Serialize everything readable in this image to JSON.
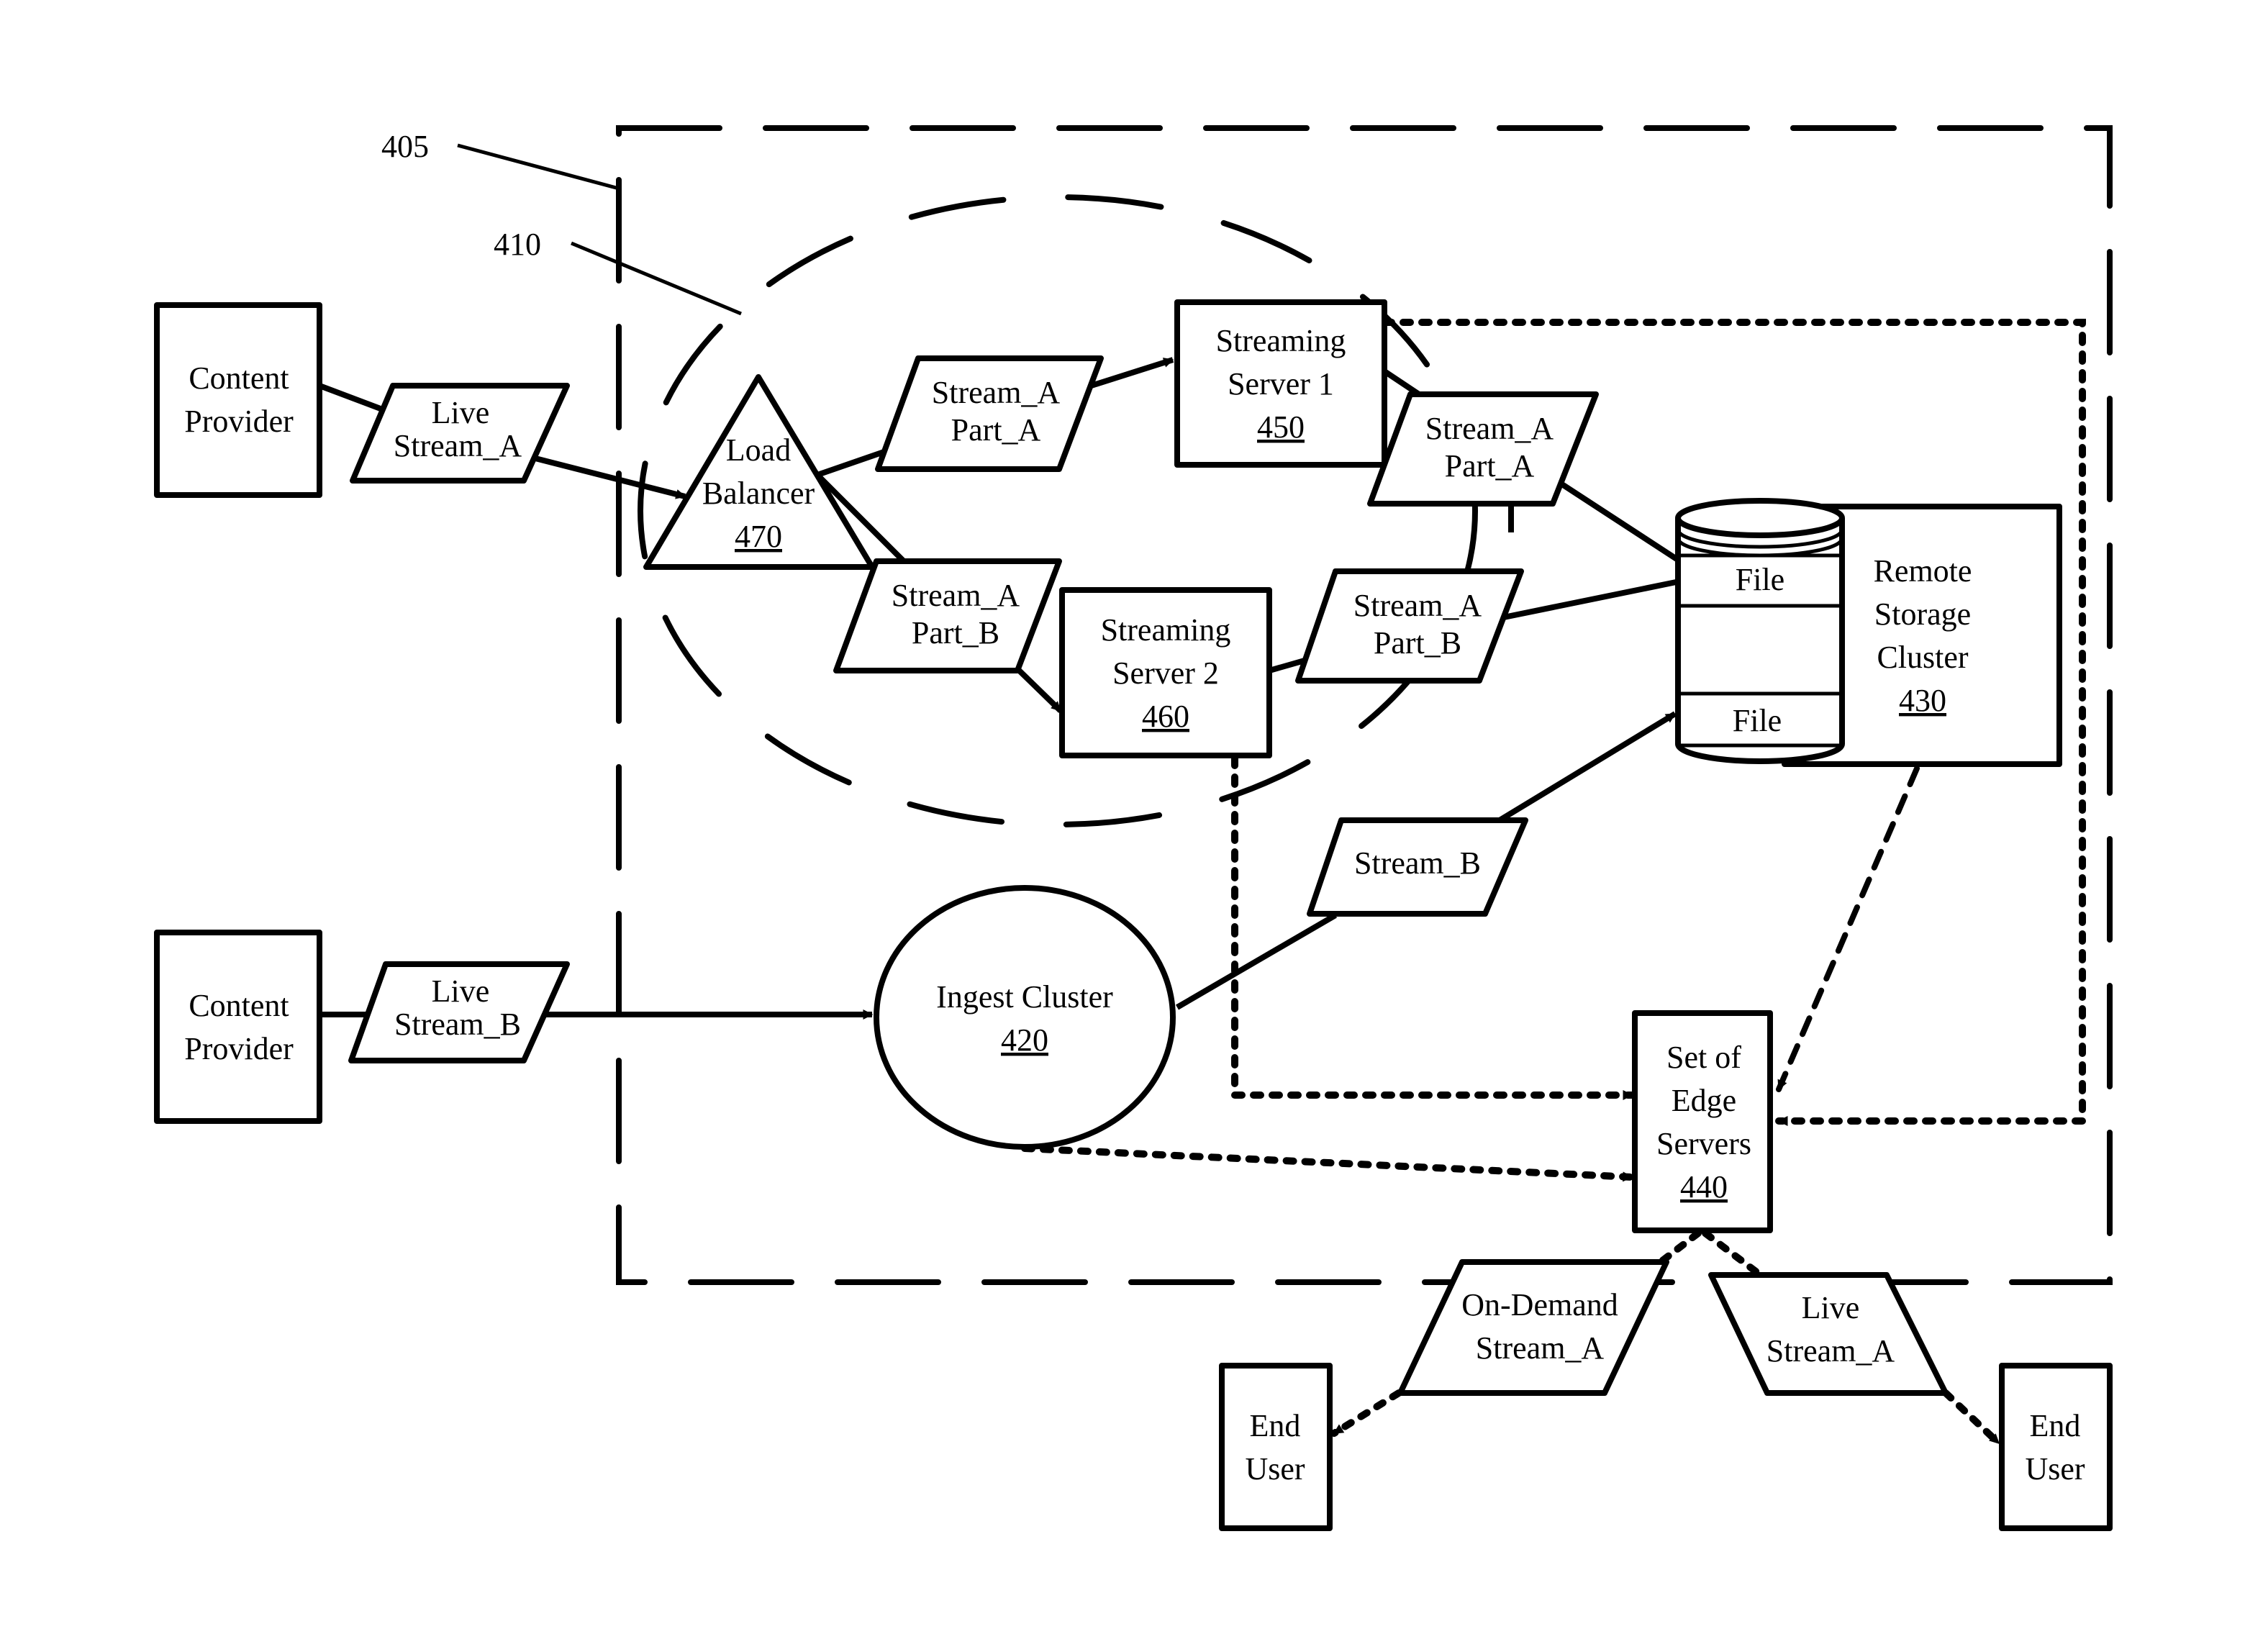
{
  "figure": {
    "callouts": {
      "outer_region": "405",
      "inner_region": "410"
    },
    "nodes": {
      "content_provider_a": {
        "lines": [
          "Content",
          "Provider"
        ]
      },
      "content_provider_b": {
        "lines": [
          "Content",
          "Provider"
        ]
      },
      "load_balancer": {
        "lines": [
          "Load",
          "Balancer"
        ],
        "ref": "470"
      },
      "streaming_server_1": {
        "lines": [
          "Streaming",
          "Server 1"
        ],
        "ref": "450"
      },
      "streaming_server_2": {
        "lines": [
          "Streaming",
          "Server 2"
        ],
        "ref": "460"
      },
      "remote_storage": {
        "lines": [
          "Remote",
          "Storage",
          "Cluster"
        ],
        "ref": "430"
      },
      "storage_files": [
        "File",
        "File"
      ],
      "ingest_cluster": {
        "lines": [
          "Ingest Cluster"
        ],
        "ref": "420"
      },
      "edge_servers": {
        "lines": [
          "Set of",
          "Edge",
          "Servers"
        ],
        "ref": "440"
      },
      "end_user_left": {
        "lines": [
          "End",
          "User"
        ]
      },
      "end_user_right": {
        "lines": [
          "End",
          "User"
        ]
      }
    },
    "data_items": {
      "live_stream_a_in": [
        "Live",
        "Stream_A"
      ],
      "live_stream_b_in": [
        "Live",
        "Stream_B"
      ],
      "stream_a_part_a_1": [
        "Stream_A",
        "Part_A"
      ],
      "stream_a_part_b_1": [
        "Stream_A",
        "Part_B"
      ],
      "stream_a_part_a_2": [
        "Stream_A",
        "Part_A"
      ],
      "stream_a_part_b_2": [
        "Stream_A",
        "Part_B"
      ],
      "stream_b": [
        "Stream_B"
      ],
      "on_demand_stream_a": [
        "On-Demand",
        "Stream_A"
      ],
      "live_stream_a_out": [
        "Live",
        "Stream_A"
      ]
    }
  }
}
